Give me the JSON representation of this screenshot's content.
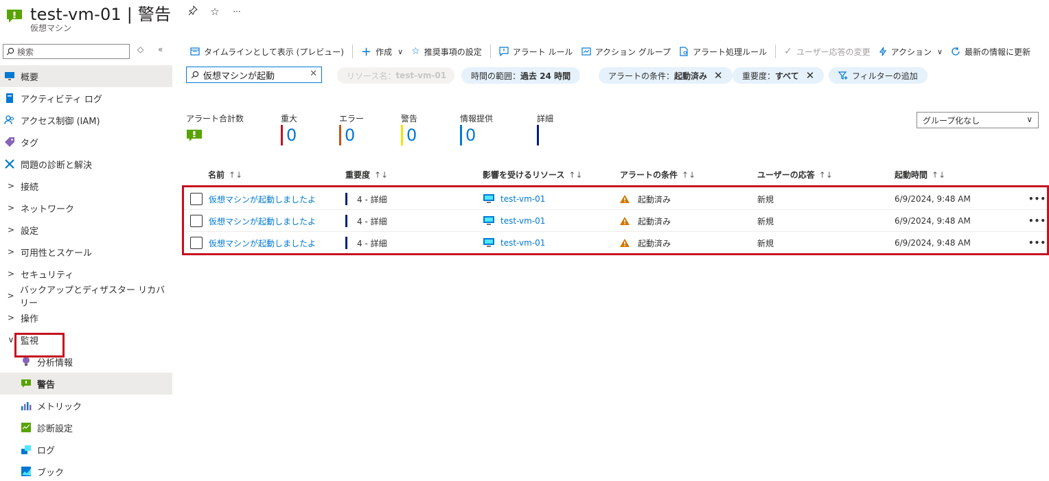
{
  "header": {
    "title": "test-vm-01 | 警告",
    "subtitle": "仮想マシン",
    "pin_label": "⊹",
    "star_label": "☆",
    "more_label": "···"
  },
  "sidebar": {
    "search_placeholder": "検索",
    "items": [
      {
        "label": "概要"
      },
      {
        "label": "アクティビティ ログ"
      },
      {
        "label": "アクセス制御 (IAM)"
      },
      {
        "label": "タグ"
      },
      {
        "label": "問題の診断と解決"
      },
      {
        "label": "接続"
      },
      {
        "label": "ネットワーク"
      },
      {
        "label": "設定"
      },
      {
        "label": "可用性とスケール"
      },
      {
        "label": "セキュリティ"
      },
      {
        "label": "バックアップとディザスター リカバリー"
      },
      {
        "label": "操作"
      },
      {
        "label": "監視"
      },
      {
        "label": "分析情報"
      },
      {
        "label": "警告"
      },
      {
        "label": "メトリック"
      },
      {
        "label": "診断設定"
      },
      {
        "label": "ログ"
      },
      {
        "label": "ブック"
      }
    ]
  },
  "toolbar": {
    "timeline": "タイムラインとして表示 (プレビュー)",
    "create": "作成",
    "recommend": "推奨事項の設定",
    "alert_rule": "アラート ルール",
    "action_group": "アクション グループ",
    "processing_rule": "アラート処理ルール",
    "user_response": "ユーザー応答の変更",
    "action": "アクション",
    "refresh": "最新の情報に更新"
  },
  "filters": {
    "search_value": "仮想マシンが起動",
    "resource_label": "リソース名：",
    "resource_value": "test-vm-01",
    "time_label": "時間の範囲：",
    "time_value": "過去 24 時間",
    "condition_label": "アラートの条件：",
    "condition_value": "起動済み",
    "severity_label": "重要度：",
    "severity_value": "すべて",
    "add_filter": "フィルターの追加"
  },
  "summary": {
    "total_label": "アラート合計数",
    "cols": [
      {
        "label": "重大",
        "value": "0",
        "color": "#c50f1f"
      },
      {
        "label": "エラー",
        "value": "0",
        "color": "#ca5010"
      },
      {
        "label": "警告",
        "value": "0",
        "color": "#fce100"
      },
      {
        "label": "情報提供",
        "value": "0",
        "color": "#0078d4"
      },
      {
        "label": "詳細",
        "value": "",
        "color": "#001e79"
      }
    ]
  },
  "group_select": {
    "value": "グループ化なし"
  },
  "table": {
    "headers": [
      "名前",
      "重要度",
      "影響を受けるリソース",
      "アラートの条件",
      "ユーザーの応答",
      "起動時間"
    ],
    "sort_glyph": "↑↓",
    "rows": [
      {
        "name": "仮想マシンが起動しましたよ",
        "severity": "4 - 詳細",
        "resource": "test-vm-01",
        "condition": "起動済み",
        "response": "新規",
        "time": "6/9/2024, 9:48 AM"
      },
      {
        "name": "仮想マシンが起動しましたよ",
        "severity": "4 - 詳細",
        "resource": "test-vm-01",
        "condition": "起動済み",
        "response": "新規",
        "time": "6/9/2024, 9:48 AM"
      },
      {
        "name": "仮想マシンが起動しましたよ",
        "severity": "4 - 詳細",
        "resource": "test-vm-01",
        "condition": "起動済み",
        "response": "新規",
        "time": "6/9/2024, 9:48 AM"
      }
    ],
    "more_label": "•••"
  },
  "colors": {
    "accent": "#0078d4",
    "highlight": "#c50f1f",
    "alert_green": "#57a300"
  }
}
